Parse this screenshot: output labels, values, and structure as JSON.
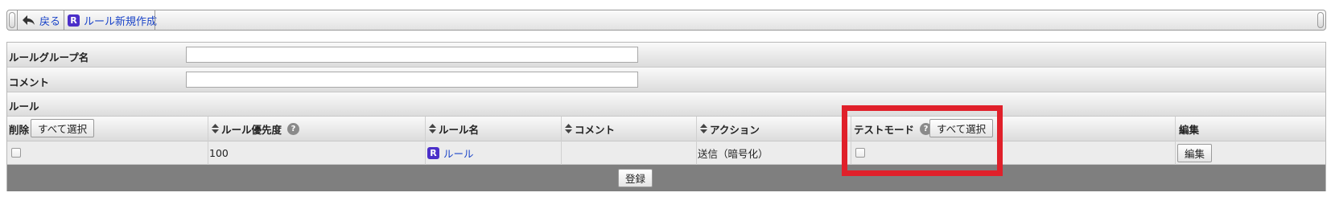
{
  "toolbar": {
    "back_label": "戻る",
    "new_rule_badge": "R",
    "new_rule_label": "ルール新規作成"
  },
  "form": {
    "group_name_label": "ルールグループ名",
    "group_name_value": "",
    "comment_label": "コメント",
    "comment_value": "",
    "rules_section_label": "ルール"
  },
  "table": {
    "headers": {
      "delete": "削除",
      "select_all_delete": "すべて選択",
      "priority": "ルール優先度",
      "rule_name": "ルール名",
      "comment": "コメント",
      "action": "アクション",
      "test_mode": "テストモード",
      "select_all_test": "すべて選択",
      "edit": "編集"
    },
    "rows": [
      {
        "delete_checked": false,
        "priority": "100",
        "rule_badge": "R",
        "rule_name": "ルール",
        "comment": "",
        "action": "送信（暗号化）",
        "test_mode_checked": false,
        "edit_label": "編集"
      }
    ]
  },
  "footer": {
    "register_label": "登録"
  },
  "icons": {
    "back": "back-arrow-icon",
    "help": "help-icon",
    "sort": "sort-icon"
  },
  "colors": {
    "link": "#1a44c8",
    "badge": "#4b2fc9",
    "highlight": "#e0202a",
    "footer_bar": "#7f7f7f"
  }
}
